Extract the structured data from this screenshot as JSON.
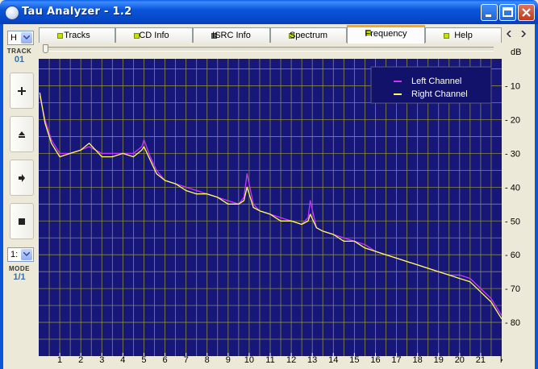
{
  "window": {
    "title": "Tau Analyzer - 1.2",
    "controls": [
      "minimize-icon",
      "maximize-icon",
      "close-icon"
    ]
  },
  "left_panel": {
    "channel_select": "H",
    "track_label": "TRACK",
    "track_number": "01",
    "buttons": [
      "plus-icon",
      "eject-icon",
      "play-icon",
      "stop-icon"
    ],
    "mode_select": "1:",
    "mode_label": "MODE",
    "mode_value": "1/1"
  },
  "tabs": [
    {
      "label": "Tracks",
      "active": false
    },
    {
      "label": "CD Info",
      "active": false
    },
    {
      "label": "ISRC Info",
      "active": false
    },
    {
      "label": "Spectrum",
      "active": false
    },
    {
      "label": "Frequency",
      "active": true
    },
    {
      "label": "Help",
      "active": false
    }
  ],
  "colors": {
    "plot_bg": "#17177a",
    "grid": "#8a8a40",
    "left_channel": "#cc33ff",
    "right_channel": "#ffff55"
  },
  "chart_data": {
    "type": "line",
    "xlabel": "kHz",
    "ylabel": "dB",
    "xlim": [
      0,
      22
    ],
    "ylim": [
      -90,
      -2
    ],
    "x_ticks": [
      1,
      2,
      3,
      4,
      5,
      6,
      7,
      8,
      9,
      10,
      11,
      12,
      13,
      14,
      15,
      16,
      17,
      18,
      19,
      20,
      21
    ],
    "y_ticks": [
      -10,
      -20,
      -30,
      -40,
      -50,
      -60,
      -70,
      -80
    ],
    "y_tick_labels": [
      "- 10",
      "- 20",
      "- 30",
      "- 40",
      "- 50",
      "- 60",
      "- 70",
      "- 80"
    ],
    "grid": true,
    "legend_position": "top-right",
    "series": [
      {
        "name": "Left Channel",
        "x": [
          0.05,
          0.3,
          0.6,
          1.0,
          1.5,
          2.0,
          2.4,
          3.0,
          3.5,
          4.0,
          4.5,
          4.9,
          5.0,
          5.3,
          5.6,
          6.0,
          6.5,
          7.0,
          7.5,
          8.0,
          8.5,
          9.0,
          9.5,
          9.75,
          9.9,
          10.2,
          10.5,
          11.0,
          11.5,
          12.0,
          12.5,
          12.8,
          12.9,
          13.2,
          13.5,
          14.0,
          14.5,
          15.0,
          15.5,
          16.0,
          16.5,
          17.0,
          17.5,
          18.0,
          18.5,
          19.0,
          19.5,
          20.0,
          20.5,
          21.0,
          21.5,
          22.0
        ],
        "values": [
          -13,
          -20,
          -26,
          -30,
          -30,
          -29,
          -28,
          -30,
          -30,
          -30,
          -30,
          -28,
          -26,
          -31,
          -35,
          -38,
          -39,
          -40,
          -41,
          -42,
          -43,
          -44,
          -45,
          -43,
          -36,
          -45,
          -47,
          -48,
          -49,
          -50,
          -51,
          -49,
          -44,
          -52,
          -53,
          -54,
          -55,
          -56,
          -57,
          -59,
          -60,
          -61,
          -62,
          -63,
          -64,
          -65,
          -66,
          -66,
          -67,
          -70,
          -73,
          -78
        ]
      },
      {
        "name": "Right Channel",
        "x": [
          0.05,
          0.3,
          0.6,
          1.0,
          1.5,
          2.0,
          2.4,
          3.0,
          3.5,
          4.0,
          4.5,
          4.9,
          5.0,
          5.3,
          5.6,
          6.0,
          6.5,
          7.0,
          7.5,
          8.0,
          8.5,
          9.0,
          9.5,
          9.75,
          9.9,
          10.2,
          10.5,
          11.0,
          11.5,
          12.0,
          12.5,
          12.8,
          12.9,
          13.2,
          13.5,
          14.0,
          14.5,
          15.0,
          15.5,
          16.0,
          16.5,
          17.0,
          17.5,
          18.0,
          18.5,
          19.0,
          19.5,
          20.0,
          20.5,
          21.0,
          21.5,
          22.0
        ],
        "values": [
          -12,
          -21,
          -27,
          -31,
          -30,
          -29,
          -27,
          -31,
          -31,
          -30,
          -31,
          -29,
          -28,
          -32,
          -36,
          -38,
          -39,
          -41,
          -42,
          -42,
          -43,
          -45,
          -45,
          -44,
          -40,
          -46,
          -47,
          -48,
          -50,
          -50,
          -51,
          -50,
          -48,
          -52,
          -53,
          -54,
          -56,
          -56,
          -58,
          -59,
          -60,
          -61,
          -62,
          -63,
          -64,
          -65,
          -66,
          -67,
          -68,
          -71,
          -74,
          -79
        ]
      }
    ]
  }
}
